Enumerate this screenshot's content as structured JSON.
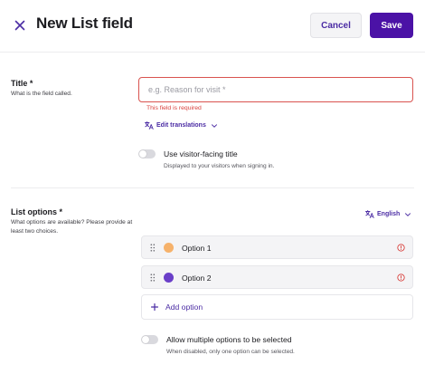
{
  "header": {
    "title": "New List field",
    "cancel_label": "Cancel",
    "save_label": "Save"
  },
  "title_section": {
    "label": "Title *",
    "description": "What is the field called.",
    "input_value": "",
    "input_placeholder": "e.g. Reason for visit *",
    "error": "This field is required",
    "edit_translations": "Edit translations",
    "visitor_toggle": {
      "label": "Use visitor-facing title",
      "description": "Displayed to your visitors when signing in.",
      "enabled": false
    }
  },
  "list_section": {
    "label": "List options *",
    "description": "What options are available? Please provide at least two choices.",
    "language": "English",
    "options": [
      {
        "label": "Option 1",
        "color": "#f6b26b"
      },
      {
        "label": "Option 2",
        "color": "#6a3fc8"
      }
    ],
    "add_option": "Add option",
    "multiple_toggle": {
      "label": "Allow multiple options to be selected",
      "description": "When disabled, only one option can be selected.",
      "enabled": false
    }
  },
  "colors": {
    "accent": "#4b12a6",
    "link": "#4b2ca4",
    "error": "#d9413d"
  },
  "icons": {
    "close": "close-icon",
    "translate": "translate-icon",
    "chevron": "chevron-down-icon",
    "drag": "drag-handle-icon",
    "warning": "warning-icon",
    "plus": "plus-icon"
  }
}
